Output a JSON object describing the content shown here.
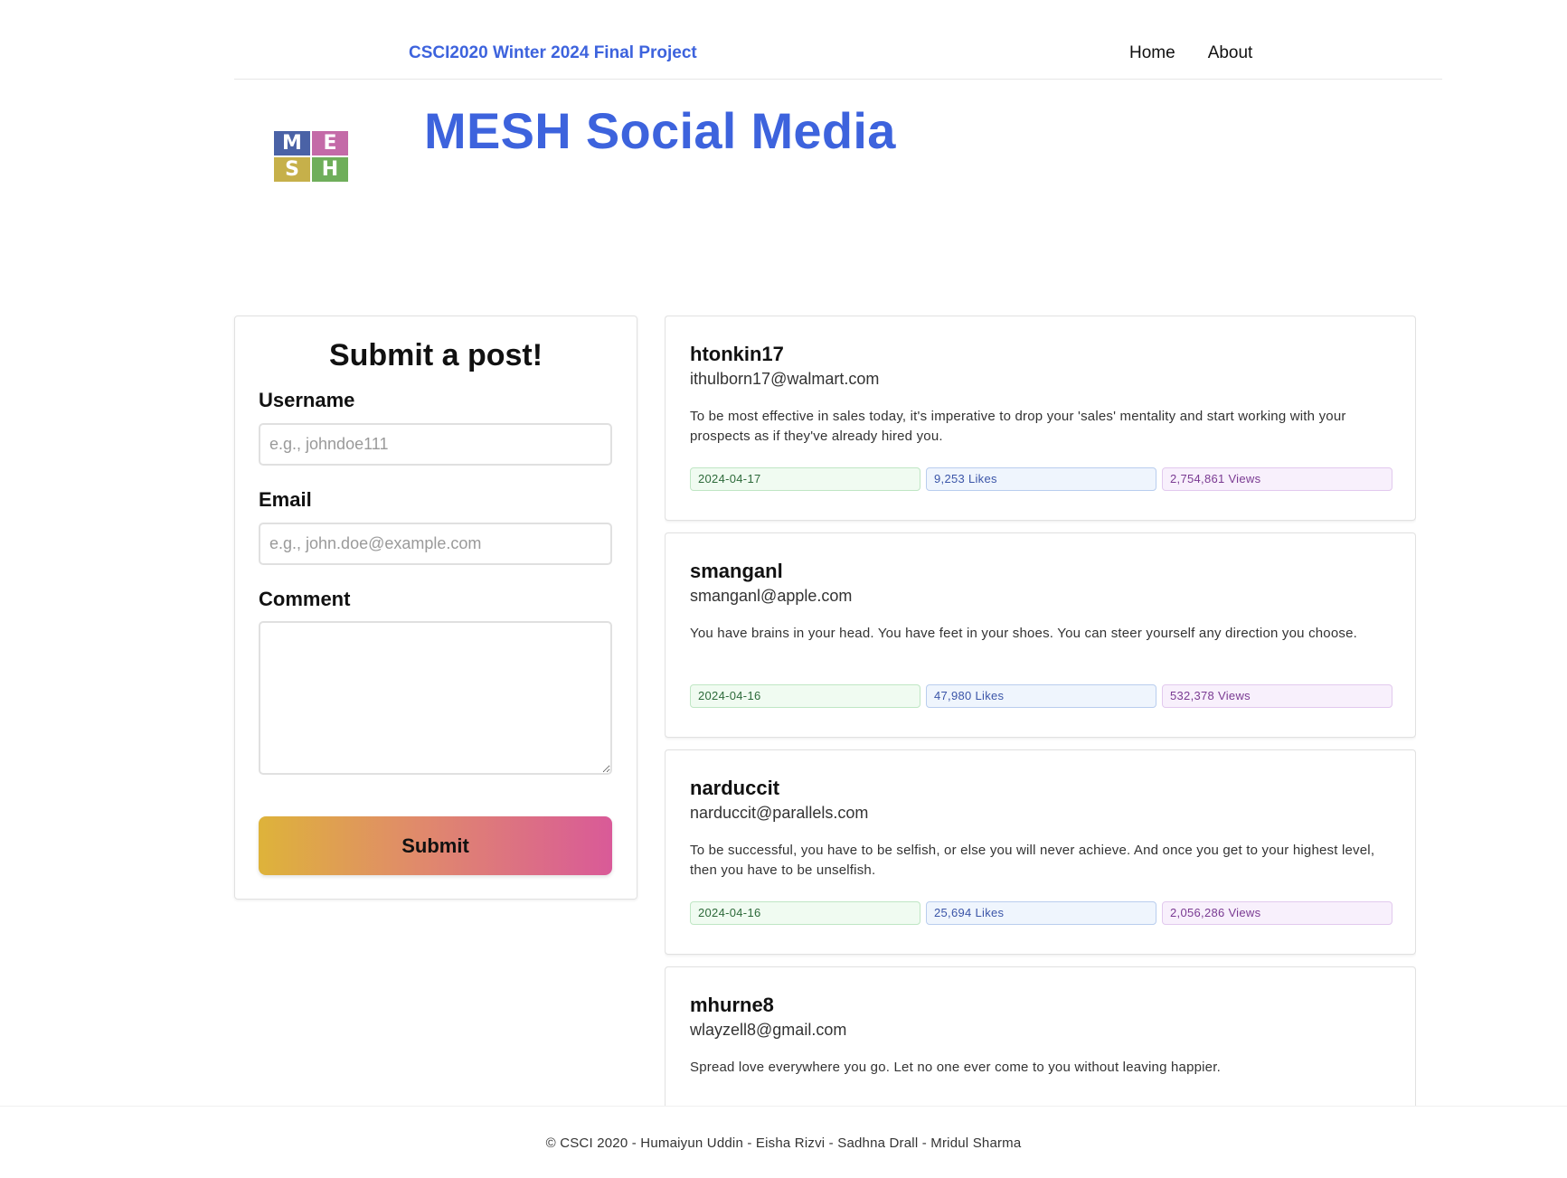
{
  "header": {
    "project_title": "CSCI2020 Winter 2024 Final Project",
    "nav": [
      {
        "label": "Home"
      },
      {
        "label": "About"
      }
    ]
  },
  "hero": {
    "logo_letters": [
      "M",
      "E",
      "S",
      "H"
    ],
    "logo_colors": [
      "#4a62a6",
      "#c46aa8",
      "#c6b04a",
      "#6fae5a"
    ],
    "title": "MESH Social Media"
  },
  "form": {
    "title": "Submit a post!",
    "username_label": "Username",
    "username_placeholder": "e.g., johndoe111",
    "email_label": "Email",
    "email_placeholder": "e.g., john.doe@example.com",
    "comment_label": "Comment",
    "submit_label": "Submit"
  },
  "posts": [
    {
      "username": "htonkin17",
      "email": "ithulborn17@walmart.com",
      "body": "To be most effective in sales today, it's imperative to drop your 'sales' mentality and start working with your prospects as if they've already hired you.",
      "date": "2024-04-17",
      "likes": "9,253 Likes",
      "views": "2,754,861 Views"
    },
    {
      "username": "smanganl",
      "email": "smanganl@apple.com",
      "body": "You have brains in your head. You have feet in your shoes. You can steer yourself any direction you choose.",
      "date": "2024-04-16",
      "likes": "47,980 Likes",
      "views": "532,378 Views"
    },
    {
      "username": "narduccit",
      "email": "narduccit@parallels.com",
      "body": "To be successful, you have to be selfish, or else you will never achieve. And once you get to your highest level, then you have to be unselfish.",
      "date": "2024-04-16",
      "likes": "25,694 Likes",
      "views": "2,056,286 Views"
    },
    {
      "username": "mhurne8",
      "email": "wlayzell8@gmail.com",
      "body": "Spread love everywhere you go. Let no one ever come to you without leaving happier."
    }
  ],
  "footer": {
    "text": "© CSCI 2020 - Humaiyun Uddin - Eisha Rizvi - Sadhna Drall - Mridul Sharma"
  },
  "colors": {
    "accent": "#3d63dd",
    "submit_gradient_start": "#deb33a",
    "submit_gradient_end": "#d95a98"
  }
}
